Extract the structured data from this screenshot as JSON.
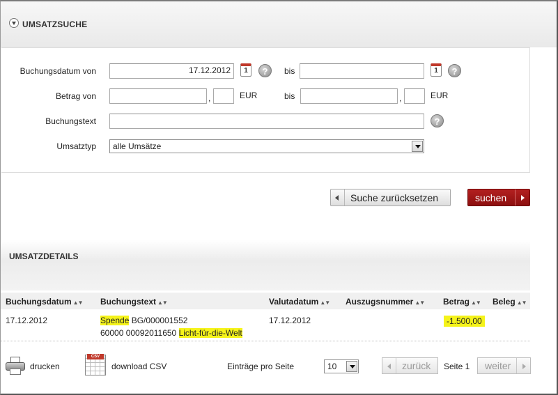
{
  "search": {
    "title": "UMSATZSUCHE",
    "booking_date_from_label": "Buchungsdatum von",
    "booking_date_from_value": "17.12.2012",
    "booking_date_to_label": "bis",
    "booking_date_to_value": "",
    "calendar_day": "1",
    "amount_from_label": "Betrag von",
    "amount_to_label": "bis",
    "decimal_separator": ",",
    "currency": "EUR",
    "booking_text_label": "Buchungstext",
    "type_label": "Umsatztyp",
    "type_value": "alle Umsätze",
    "help_symbol": "?",
    "reset_button": "Suche zurücksetzen",
    "search_button": "suchen"
  },
  "details": {
    "title": "UMSATZDETAILS",
    "columns": [
      "Buchungsdatum",
      "Buchungstext",
      "Valutadatum",
      "Auszugsnummer",
      "Betrag",
      "Beleg"
    ],
    "sort_symbol": "▲▼",
    "rows": [
      {
        "booking_date": "17.12.2012",
        "text_line1_highlight": "Spende",
        "text_line1_rest": " BG/000001552",
        "text_line2_prefix": "60000 00092011650 ",
        "text_line2_highlight": "Licht-für-die-Welt",
        "value_date": "17.12.2012",
        "statement_no": "",
        "amount": "-1.500,00",
        "receipt": ""
      }
    ]
  },
  "footer": {
    "print_label": "drucken",
    "csv_badge": "CSV",
    "csv_label": "download CSV",
    "per_page_label": "Einträge pro Seite",
    "per_page_value": "10",
    "prev_label": "zurück",
    "page_label": "Seite 1",
    "next_label": "weiter"
  },
  "colors": {
    "accent_red": "#a01818",
    "highlight": "#f5f31a"
  }
}
